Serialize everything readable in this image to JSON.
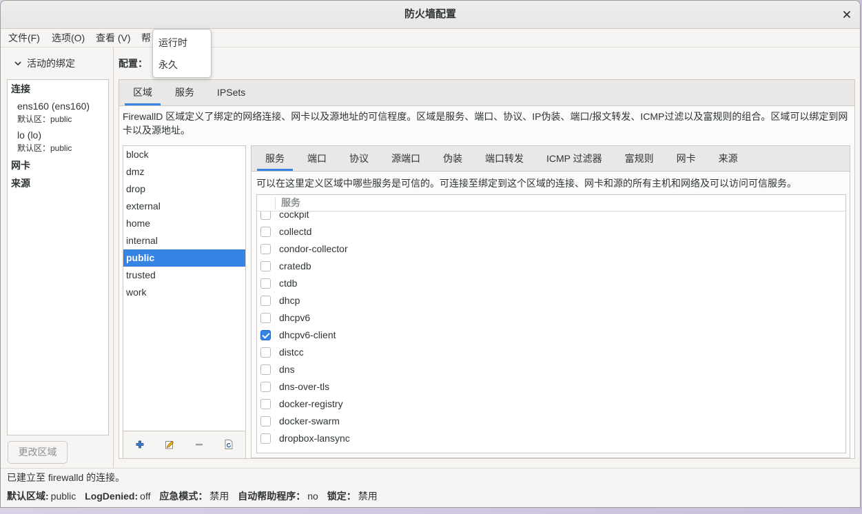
{
  "window": {
    "title": "防火墙配置"
  },
  "theme": {
    "accent": "#3584e4"
  },
  "icons": {
    "close": "close-icon",
    "expander": "chevron-down-icon",
    "add": "add-icon",
    "edit": "edit-icon",
    "remove": "remove-icon",
    "reload": "reload-icon"
  },
  "menubar": {
    "file": "文件(F)",
    "options": "选项(O)",
    "view": "查看 (V)",
    "help": "帮"
  },
  "config_menu": {
    "label": "配置：",
    "options": [
      "运行时",
      "永久"
    ]
  },
  "bindings": {
    "header": "活动的绑定",
    "connections_label": "连接",
    "connections": [
      {
        "name": "ens160 (ens160)",
        "zone": "默认区：public"
      },
      {
        "name": "lo (lo)",
        "zone": "默认区：public"
      }
    ],
    "interfaces_label": "网卡",
    "sources_label": "来源",
    "change_zone_button": "更改区域"
  },
  "main_tabs": [
    {
      "label": "区域",
      "active": true
    },
    {
      "label": "服务",
      "active": false
    },
    {
      "label": "IPSets",
      "active": false
    }
  ],
  "zones": {
    "description": "FirewallD 区域定义了绑定的网络连接、网卡以及源地址的可信程度。区域是服务、端口、协议、IP伪装、端口/报文转发、ICMP过滤以及富规则的组合。区域可以绑定到网卡以及源地址。",
    "items": [
      {
        "name": "block",
        "selected": false
      },
      {
        "name": "dmz",
        "selected": false
      },
      {
        "name": "drop",
        "selected": false
      },
      {
        "name": "external",
        "selected": false
      },
      {
        "name": "home",
        "selected": false
      },
      {
        "name": "internal",
        "selected": false
      },
      {
        "name": "public",
        "selected": true
      },
      {
        "name": "trusted",
        "selected": false
      },
      {
        "name": "work",
        "selected": false
      }
    ]
  },
  "zone_tabs": [
    {
      "label": "服务",
      "active": true
    },
    {
      "label": "端口",
      "active": false
    },
    {
      "label": "协议",
      "active": false
    },
    {
      "label": "源端口",
      "active": false
    },
    {
      "label": "伪装",
      "active": false
    },
    {
      "label": "端口转发",
      "active": false
    },
    {
      "label": "ICMP 过滤器",
      "active": false
    },
    {
      "label": "富规则",
      "active": false
    },
    {
      "label": "网卡",
      "active": false
    },
    {
      "label": "来源",
      "active": false
    }
  ],
  "services": {
    "description": "可以在这里定义区域中哪些服务是可信的。可连接至绑定到这个区域的连接、网卡和源的所有主机和网络及可以访问可信服务。",
    "column_header": "服务",
    "items": [
      {
        "name": "cockpit",
        "checked": false
      },
      {
        "name": "collectd",
        "checked": false
      },
      {
        "name": "condor-collector",
        "checked": false
      },
      {
        "name": "cratedb",
        "checked": false
      },
      {
        "name": "ctdb",
        "checked": false
      },
      {
        "name": "dhcp",
        "checked": false
      },
      {
        "name": "dhcpv6",
        "checked": false
      },
      {
        "name": "dhcpv6-client",
        "checked": true
      },
      {
        "name": "distcc",
        "checked": false
      },
      {
        "name": "dns",
        "checked": false
      },
      {
        "name": "dns-over-tls",
        "checked": false
      },
      {
        "name": "docker-registry",
        "checked": false
      },
      {
        "name": "docker-swarm",
        "checked": false
      },
      {
        "name": "dropbox-lansync",
        "checked": false
      }
    ]
  },
  "status": {
    "connection": "已建立至 firewalld 的连接。",
    "fields": [
      {
        "label": "默认区域:",
        "value": "public"
      },
      {
        "label": "LogDenied:",
        "value": "off"
      },
      {
        "label": "应急模式：",
        "value": "禁用"
      },
      {
        "label": "自动帮助程序：",
        "value": "no"
      },
      {
        "label": "锁定：",
        "value": "禁用"
      }
    ]
  }
}
